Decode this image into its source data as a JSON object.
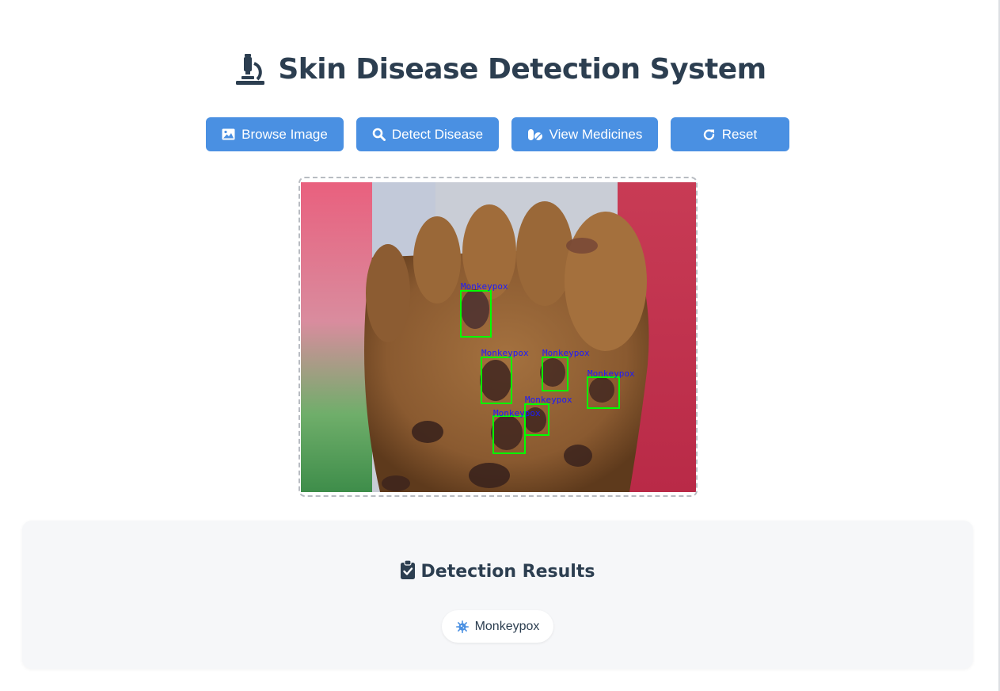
{
  "header": {
    "title": "Skin Disease Detection System",
    "icon": "microscope-icon"
  },
  "toolbar": {
    "buttons": [
      {
        "label": "Browse Image",
        "icon": "image-icon"
      },
      {
        "label": "Detect Disease",
        "icon": "search-icon"
      },
      {
        "label": "View Medicines",
        "icon": "pills-icon"
      },
      {
        "label": "Reset",
        "icon": "redo-icon"
      }
    ]
  },
  "image": {
    "detections": [
      {
        "label": "Monkeypox"
      },
      {
        "label": "Monkeypox"
      },
      {
        "label": "Monkeypox"
      },
      {
        "label": "Monkeypox"
      },
      {
        "label": "Monkeypox"
      },
      {
        "label": "Monkeypox"
      }
    ]
  },
  "results": {
    "title": "Detection Results",
    "title_icon": "clipboard-check-icon",
    "items": [
      {
        "label": "Monkeypox",
        "icon": "virus-icon"
      }
    ]
  },
  "colors": {
    "primary": "#4a90e2",
    "text": "#2c3e50",
    "panel_bg": "#f6f7f9",
    "box": "#00ff00",
    "box_label": "#1a1aff"
  }
}
